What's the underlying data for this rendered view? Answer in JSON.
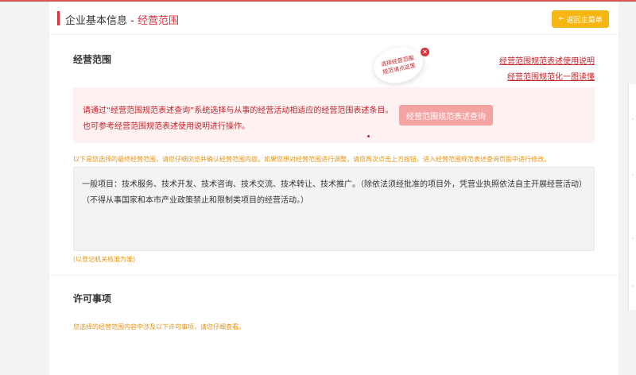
{
  "header": {
    "title": "企业基本信息",
    "separator": " - ",
    "crumb": "经营范围",
    "back_icon": "arrow-left-icon",
    "back_label": "返回主菜单"
  },
  "scope_section": {
    "title": "经营范围",
    "tooltip_text": "选择经营范围规范请点这里",
    "links": [
      "经营范围规范表述使用说明",
      "经营范围规范化一图读懂"
    ],
    "notice_line1": "请通过“经营范围规范表述查询”系统选择与从事的经营活动相适应的经营范围表述条目。",
    "notice_line2": "也可参考经营范围规范表述使用说明进行操作。",
    "query_button": "经营范围规范表述查询",
    "hint": "以下是您选择的最终经营范围，请您仔细浏览并确认经营范围内容。如果您想对经营范围进行调整，请您再次点击上方按钮，进入经营范围规范表述查询页面中进行修改。",
    "content": "一般项目：技术服务、技术开发、技术咨询、技术交流、技术转让、技术推广。（除依法须经批准的项目外，凭营业执照依法自主开展经营活动）（不得从事国家和本市产业政策禁止和限制类项目的经营活动。）",
    "footnote": "(以登记机关核准为准)"
  },
  "permit_section": {
    "title": "许可事项",
    "hint": "您选择的经营范围内容中涉及以下许可事项，请您仔细查看。"
  },
  "colors": {
    "accent": "#d6343a",
    "button_orange": "#f6b712",
    "notice_bg": "#fdf1f1",
    "hint_orange": "#e8930c"
  }
}
